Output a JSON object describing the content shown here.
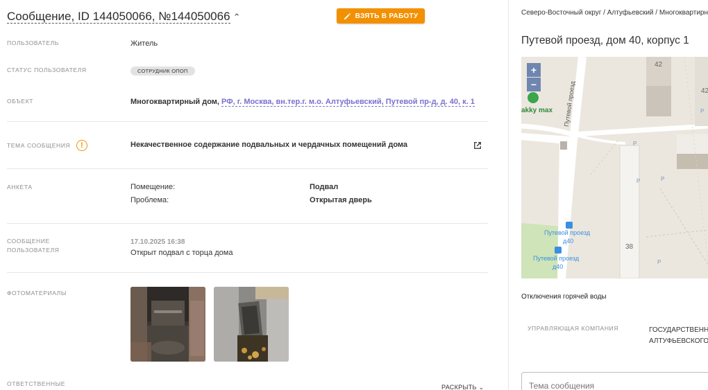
{
  "header": {
    "title": "Сообщение, ID 144050066, №144050066",
    "take_button_label": "ВЗЯТЬ В РАБОТУ"
  },
  "fields": {
    "user_label": "ПОЛЬЗОВАТЕЛЬ",
    "user_value": "Житель",
    "user_status_label": "СТАТУС ПОЛЬЗОВАТЕЛЯ",
    "user_status_badge": "СОТРУДНИК ОПОП",
    "object_label": "ОБЪЕКТ",
    "object_type": "Многоквартирный дом,",
    "object_address_link": "РФ, г. Москва, вн.тер.г. м.о. Алтуфьевский, Путевой пр-д, д. 40, к. 1",
    "topic_label": "ТЕМА СООБЩЕНИЯ",
    "topic_value": "Некачественное содержание подвальных и чердачных помещений дома",
    "survey_label": "АНКЕТА",
    "survey": [
      {
        "question": "Помещение:",
        "answer": "Подвал"
      },
      {
        "question": "Проблема:",
        "answer": "Открытая дверь"
      }
    ],
    "user_message_label_line1": "СООБЩЕНИЕ",
    "user_message_label_line2": "ПОЛЬЗОВАТЕЛЯ",
    "user_message_date": "17.10.2025 16:38",
    "user_message_text": "Открыт подвал с торца дома",
    "photos_label": "ФОТОМАТЕРИАЛЫ",
    "responsible_label": "ОТВЕТСТВЕННЫЕ",
    "expand_label": "РАСКРЫТЬ"
  },
  "side": {
    "breadcrumb": "Северо-Восточный округ / Алтуфьевский / Многоквартирный",
    "address_title": "Путевой проезд, дом 40, корпус 1",
    "map": {
      "zoom_in": "+",
      "zoom_out": "−",
      "street_label": "Путевой проезд",
      "store_label": "akky max",
      "stop_label_1a": "Путевой проезд",
      "stop_label_1b": "д40",
      "stop_label_2a": "Путевой проезд",
      "stop_label_2b": "д40",
      "house_42": "42",
      "house_42_partial": "42",
      "house_38": "38",
      "parking": "P"
    },
    "hot_water_title": "Отключения горячей воды",
    "management_label": "УПРАВЛЯЮЩАЯ КОМПАНИЯ",
    "management_value_line1": "ГОСУДАРСТВЕННОЕ",
    "management_value_line2": "АЛТУФЬЕВСКОГО",
    "topic_input_placeholder": "Тема сообщения"
  },
  "colors": {
    "accent_orange": "#f39000",
    "link_purple": "#7a6fd0",
    "badge_gray": "#e2e2e2"
  }
}
